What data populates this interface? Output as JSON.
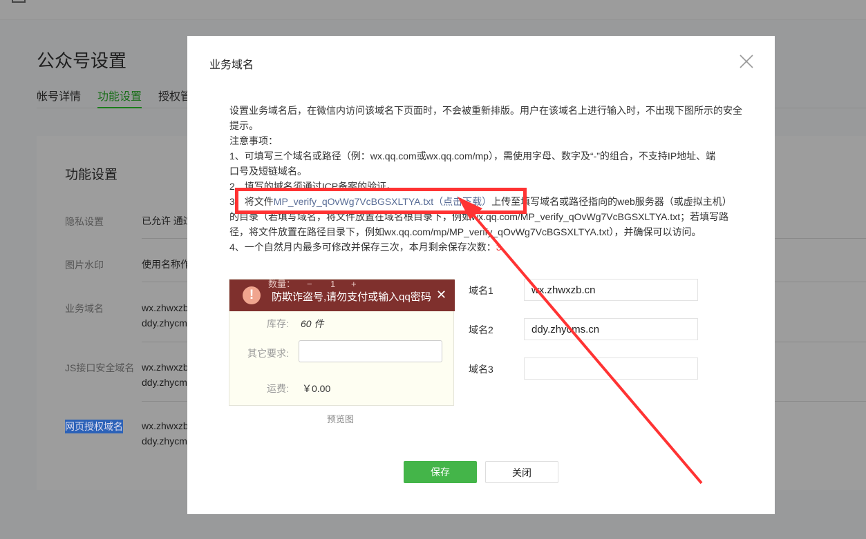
{
  "page": {
    "title": "公众号设置",
    "tabs": [
      {
        "label": "帐号详情"
      },
      {
        "label": "功能设置"
      },
      {
        "label": "授权管"
      }
    ]
  },
  "card": {
    "title": "功能设置",
    "rows": [
      {
        "label": "隐私设置",
        "value": "已允许 通过",
        "value2": ""
      },
      {
        "label": "图片水印",
        "value": "使用名称作",
        "value2": ""
      },
      {
        "label": "业务域名",
        "value": "wx.zhwxzb",
        "value2": "ddy.zhycm"
      },
      {
        "label": "JS接口安全域名",
        "value": "wx.zhwxzb",
        "value2": "ddy.zhycm"
      },
      {
        "label": "网页授权域名",
        "value": "wx.zhwxzb",
        "value2": "ddy.zhycm"
      }
    ]
  },
  "modal": {
    "title": "业务域名",
    "desc": {
      "l1": "设置业务域名后，在微信内访问该域名下页面时，不会被重新排版。用户在该域名上进行输入时，不出现下图所示的安全",
      "l2": "提示。",
      "l3": "注意事项：",
      "l4": "1、可填写三个域名或路径（例：wx.qq.com或wx.qq.com/mp），需使用字母、数字及“-”的组合，不支持IP地址、端",
      "l5": "口号及短链域名。",
      "l6": "2、填写的域名须通过ICP备案的验证。",
      "l7a": "3、将文件",
      "l7link": "MP_verify_qOvWg7VcBGSXLTYA.txt（点击下载）",
      "l7b": "上传至填写域名或路径指向的web服务器（或虚拟主机）",
      "l8": "的目录（若填写域名，将文件放置在域名根目录下，例如wx.qq.com/MP_verify_qOvWg7VcBGSXLTYA.txt；若填写路",
      "l9": "径，将文件放置在路径目录下，例如wx.qq.com/mp/MP_verify_qOvWg7VcBGSXLTYA.txt），并确保可以访问。",
      "l10": "4、一个自然月内最多可修改并保存三次，本月剩余保存次数：",
      "remaining": "3"
    },
    "preview": {
      "banner": "防欺诈盗号,请勿支付或输入qq密码",
      "qty_label": "数量：",
      "qty": "1",
      "stock_label": "库存:",
      "stock": "60 件",
      "other_label": "其它要求:",
      "ship_label": "运费:",
      "ship": "￥0.00",
      "caption": "预览图"
    },
    "domains": [
      {
        "label": "域名1",
        "value": "wx.zhwxzb.cn"
      },
      {
        "label": "域名2",
        "value": "ddy.zhycms.cn"
      },
      {
        "label": "域名3",
        "value": ""
      }
    ],
    "save": "保存",
    "close": "关闭"
  },
  "colors": {
    "accent": "#44b549",
    "link": "#576b95",
    "annotation": "#ff3333",
    "banner": "#7f302d"
  }
}
